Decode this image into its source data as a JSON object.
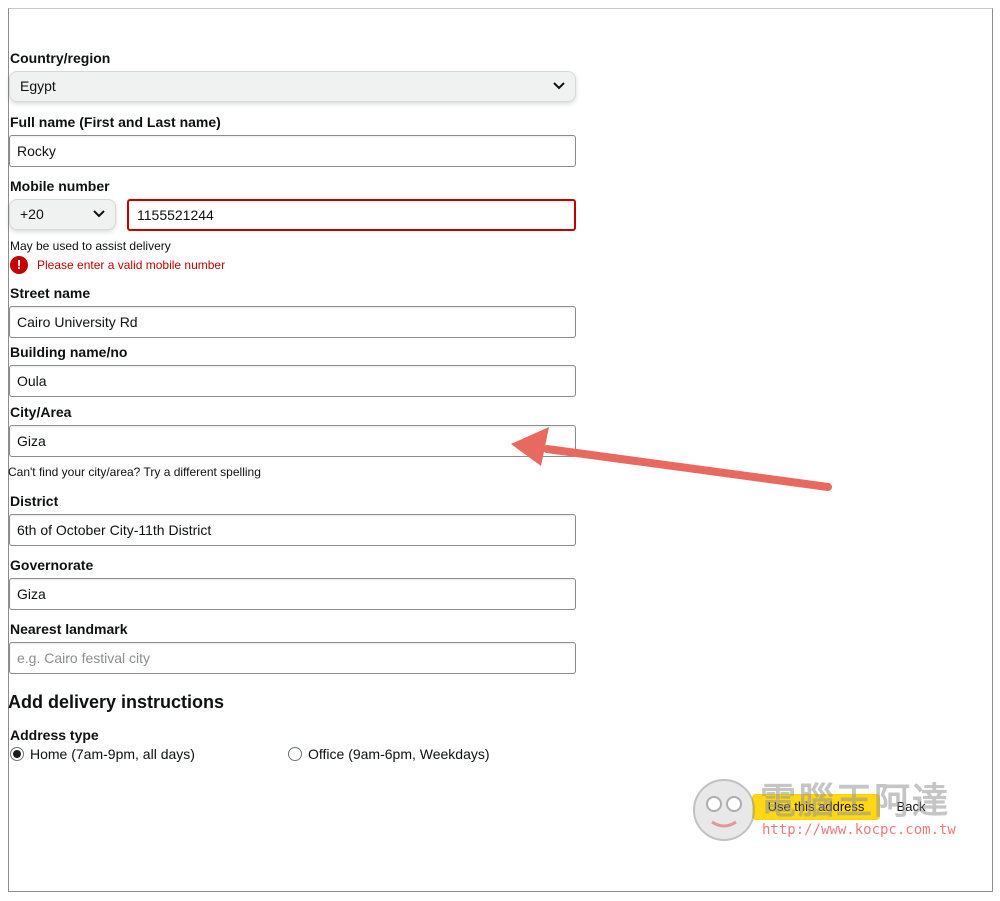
{
  "country": {
    "label": "Country/region",
    "value": "Egypt"
  },
  "full_name": {
    "label": "Full name (First and Last name)",
    "value": "Rocky"
  },
  "mobile": {
    "label": "Mobile number",
    "code": "+20",
    "value": "1155521244",
    "hint": "May be used to assist delivery",
    "error_icon": "!",
    "error": "Please enter a valid mobile number"
  },
  "street": {
    "label": "Street name",
    "value": "Cairo University Rd"
  },
  "building": {
    "label": "Building name/no",
    "value": "Oula"
  },
  "city": {
    "label": "City/Area",
    "value": "Giza",
    "hint": "Can't find your city/area? Try a different spelling"
  },
  "district": {
    "label": "District",
    "value": "6th of October City-11th District"
  },
  "governorate": {
    "label": "Governorate",
    "value": "Giza"
  },
  "landmark": {
    "label": "Nearest landmark",
    "placeholder": "e.g. Cairo festival city"
  },
  "instructions": {
    "heading": "Add delivery instructions"
  },
  "address_type": {
    "label": "Address type",
    "options": [
      {
        "label": "Home (7am-9pm, all days)",
        "checked": true
      },
      {
        "label": "Office (9am-6pm, Weekdays)",
        "checked": false
      }
    ]
  },
  "actions": {
    "submit_label": "Use this address",
    "back_label": "Back"
  },
  "watermark": {
    "title": "電腦王阿達",
    "url": "http://www.kocpc.com.tw"
  },
  "colors": {
    "error": "#c40000",
    "primary_button": "#ffd814",
    "arrow": "#e8695f"
  },
  "icons": [
    "chevron-down-icon",
    "error-icon",
    "radio-icon",
    "arrow-annotation-icon"
  ]
}
